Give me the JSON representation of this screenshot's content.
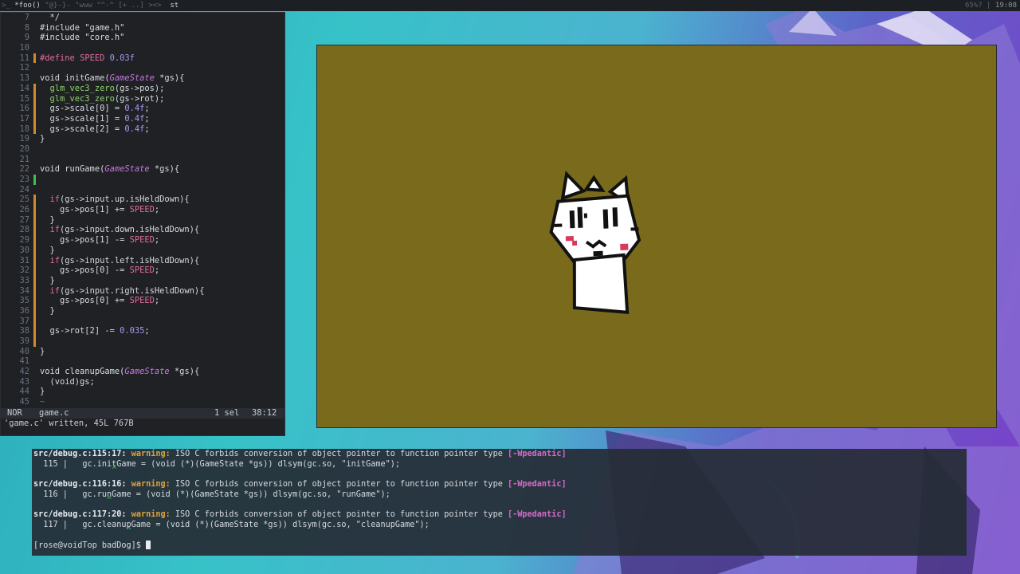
{
  "topbar": {
    "tags_left": ">_",
    "tags_active": "*foo()",
    "tags_rest": " °@}-}- \"www \"^-^ [+ ..] ><> ",
    "tags_st": "st",
    "status": "65%? | ",
    "clock": "19:08"
  },
  "editor": {
    "lines": [
      {
        "n": "7",
        "mark": "",
        "text": "  */"
      },
      {
        "n": "8",
        "mark": "",
        "text": "#include \"game.h\""
      },
      {
        "n": "9",
        "mark": "",
        "text": "#include \"core.h\""
      },
      {
        "n": "10",
        "mark": "",
        "text": ""
      },
      {
        "n": "11",
        "mark": "mod",
        "text": "#define SPEED 0.03f"
      },
      {
        "n": "12",
        "mark": "",
        "text": ""
      },
      {
        "n": "13",
        "mark": "",
        "text": "void initGame(GameState *gs){"
      },
      {
        "n": "14",
        "mark": "mod",
        "text": "  glm_vec3_zero(gs->pos);"
      },
      {
        "n": "15",
        "mark": "mod",
        "text": "  glm_vec3_zero(gs->rot);"
      },
      {
        "n": "16",
        "mark": "mod",
        "text": "  gs->scale[0] = 0.4f;"
      },
      {
        "n": "17",
        "mark": "mod",
        "text": "  gs->scale[1] = 0.4f;"
      },
      {
        "n": "18",
        "mark": "mod",
        "text": "  gs->scale[2] = 0.4f;"
      },
      {
        "n": "19",
        "mark": "",
        "text": "}"
      },
      {
        "n": "20",
        "mark": "",
        "text": ""
      },
      {
        "n": "21",
        "mark": "",
        "text": ""
      },
      {
        "n": "22",
        "mark": "",
        "text": "void runGame(GameState *gs){"
      },
      {
        "n": "23",
        "mark": "add",
        "text": ""
      },
      {
        "n": "24",
        "mark": "",
        "text": ""
      },
      {
        "n": "25",
        "mark": "mod",
        "text": "  if(gs->input.up.isHeldDown){"
      },
      {
        "n": "26",
        "mark": "mod",
        "text": "    gs->pos[1] += SPEED;"
      },
      {
        "n": "27",
        "mark": "mod",
        "text": "  }"
      },
      {
        "n": "28",
        "mark": "mod",
        "text": "  if(gs->input.down.isHeldDown){"
      },
      {
        "n": "29",
        "mark": "mod",
        "text": "    gs->pos[1] -= SPEED;"
      },
      {
        "n": "30",
        "mark": "mod",
        "text": "  }"
      },
      {
        "n": "31",
        "mark": "mod",
        "text": "  if(gs->input.left.isHeldDown){"
      },
      {
        "n": "32",
        "mark": "mod",
        "text": "    gs->pos[0] -= SPEED;"
      },
      {
        "n": "33",
        "mark": "mod",
        "text": "  }"
      },
      {
        "n": "34",
        "mark": "mod",
        "text": "  if(gs->input.right.isHeldDown){"
      },
      {
        "n": "35",
        "mark": "mod",
        "text": "    gs->pos[0] += SPEED;"
      },
      {
        "n": "36",
        "mark": "mod",
        "text": "  }"
      },
      {
        "n": "37",
        "mark": "mod",
        "text": ""
      },
      {
        "n": "38",
        "mark": "mod",
        "text": "  gs->rot[2] -= 0.035;"
      },
      {
        "n": "39",
        "mark": "mod",
        "text": ""
      },
      {
        "n": "40",
        "mark": "",
        "text": "}"
      },
      {
        "n": "41",
        "mark": "",
        "text": ""
      },
      {
        "n": "42",
        "mark": "",
        "text": "void cleanupGame(GameState *gs){"
      },
      {
        "n": "43",
        "mark": "",
        "text": "  (void)gs;"
      },
      {
        "n": "44",
        "mark": "",
        "text": "}"
      },
      {
        "n": "45",
        "mark": "",
        "text": "~"
      }
    ],
    "status": {
      "mode": "NOR",
      "file": "game.c",
      "selections": "1 sel",
      "position": "38:12"
    },
    "command_message": "'game.c' written, 45L 767B"
  },
  "terminal": {
    "warnings": [
      {
        "location": "src/debug.c:115:17:",
        "label": "warning:",
        "message": " ISO C forbids conversion of object pointer to function pointer type ",
        "flag": "[-Wpedantic]",
        "code_line": "  115 |   gc.initGame = (void (*)(GameState *gs)) dlsym(gc.so, \"initGame\");",
        "caret": "                ^"
      },
      {
        "location": "src/debug.c:116:16:",
        "label": "warning:",
        "message": " ISO C forbids conversion of object pointer to function pointer type ",
        "flag": "[-Wpedantic]",
        "code_line": "  116 |   gc.runGame = (void (*)(GameState *gs)) dlsym(gc.so, \"runGame\");",
        "caret": "               ^"
      },
      {
        "location": "src/debug.c:117:20:",
        "label": "warning:",
        "message": " ISO C forbids conversion of object pointer to function pointer type ",
        "flag": "[-Wpedantic]",
        "code_line": "  117 |   gc.cleanupGame = (void (*)(GameState *gs)) dlsym(gc.so, \"cleanupGame\");",
        "caret": "                   ^"
      }
    ],
    "prompt": "[rose@voidTop badDog]$ "
  },
  "colors": {
    "game_background": "#7a6a1c",
    "editor_background": "#1f2125",
    "terminal_background": "#262c36",
    "warning": "#e0a23a",
    "flag": "#d66ac7"
  }
}
